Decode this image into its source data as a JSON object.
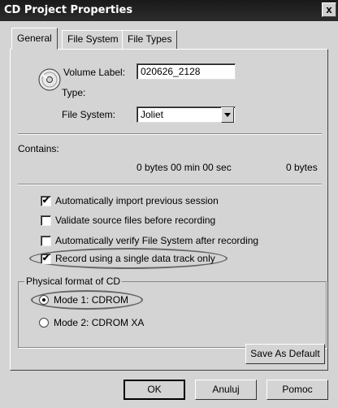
{
  "window": {
    "title": "CD Project Properties",
    "close": "x"
  },
  "tabs": [
    {
      "label": "General"
    },
    {
      "label": "File System"
    },
    {
      "label": "File Types"
    }
  ],
  "general": {
    "volume_label": "Volume Label:",
    "volume_value": "020626_2128",
    "type_label": "Type:",
    "fs_label": "File System:",
    "fs_value": "Joliet",
    "contains_label": "Contains:",
    "contains_summary": "0 bytes 00 min 00 sec",
    "contains_bytes": "0 bytes"
  },
  "options": [
    {
      "label": "Automatically import previous session",
      "checked": true
    },
    {
      "label": "Validate source files before recording",
      "checked": false
    },
    {
      "label": "Automatically verify File System after recording",
      "checked": false
    },
    {
      "label": "Record using a single data track only",
      "checked": true
    }
  ],
  "physical": {
    "title": "Physical format of CD",
    "mode1": "Mode 1: CDROM",
    "mode2": "Mode 2: CDROM XA",
    "selected": "Mode 1: CDROM"
  },
  "buttons": {
    "save_default": "Save As Default",
    "ok": "OK",
    "cancel": "Anuluj",
    "help": "Pomoc"
  },
  "checkmark": "✔"
}
